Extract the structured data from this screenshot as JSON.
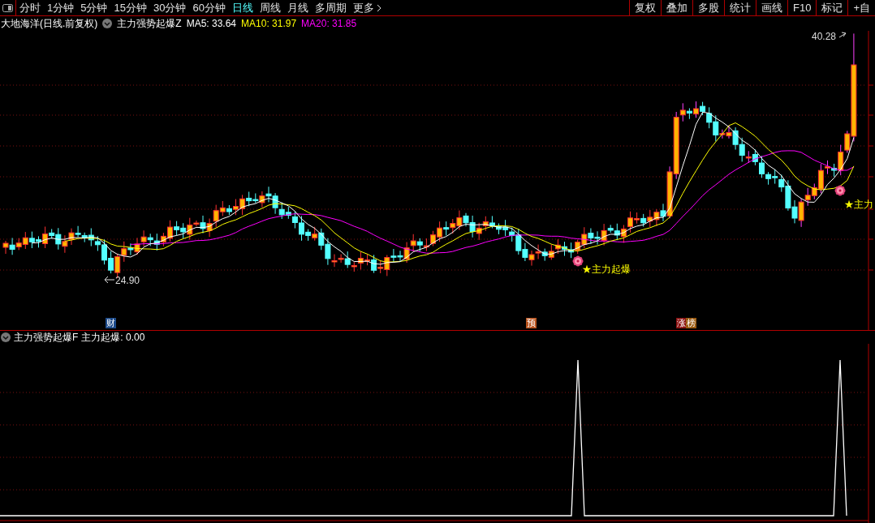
{
  "toolbar": {
    "periods": [
      {
        "label": "分时",
        "selected": false
      },
      {
        "label": "1分钟",
        "selected": false
      },
      {
        "label": "5分钟",
        "selected": false
      },
      {
        "label": "15分钟",
        "selected": false
      },
      {
        "label": "30分钟",
        "selected": false
      },
      {
        "label": "60分钟",
        "selected": false
      },
      {
        "label": "日线",
        "selected": true
      },
      {
        "label": "周线",
        "selected": false
      },
      {
        "label": "月线",
        "selected": false
      },
      {
        "label": "多周期",
        "selected": false
      },
      {
        "label": "更多",
        "selected": false
      }
    ],
    "buttons": [
      "复权",
      "叠加",
      "多股",
      "统计",
      "画线",
      "F10",
      "标记",
      "+自"
    ]
  },
  "header": {
    "stock": "大地海洋(日线.前复权)",
    "indicator": "主力强势起爆Z",
    "mas": [
      {
        "label": "MA5: 33.64",
        "color": "#ffffff"
      },
      {
        "label": "MA10: 31.97",
        "color": "#ffff00"
      },
      {
        "label": "MA20: 31.85",
        "color": "#ff00ff"
      }
    ]
  },
  "main_chart": {
    "high_label": "40.28",
    "low_label": "24.90",
    "signals": [
      {
        "text": "★主力起爆"
      },
      {
        "text": "★主力"
      }
    ],
    "events": [
      {
        "text": "财",
        "color": "#1c4a8a"
      },
      {
        "text": "预",
        "color": "#b8521c"
      },
      {
        "text": "涨",
        "color": "#8a1010"
      },
      {
        "text": "榜",
        "color": "#9a5a10"
      }
    ]
  },
  "lower_panel": {
    "indicator": "主力强势起爆F",
    "reading": "主力起爆: 0.00"
  }
}
